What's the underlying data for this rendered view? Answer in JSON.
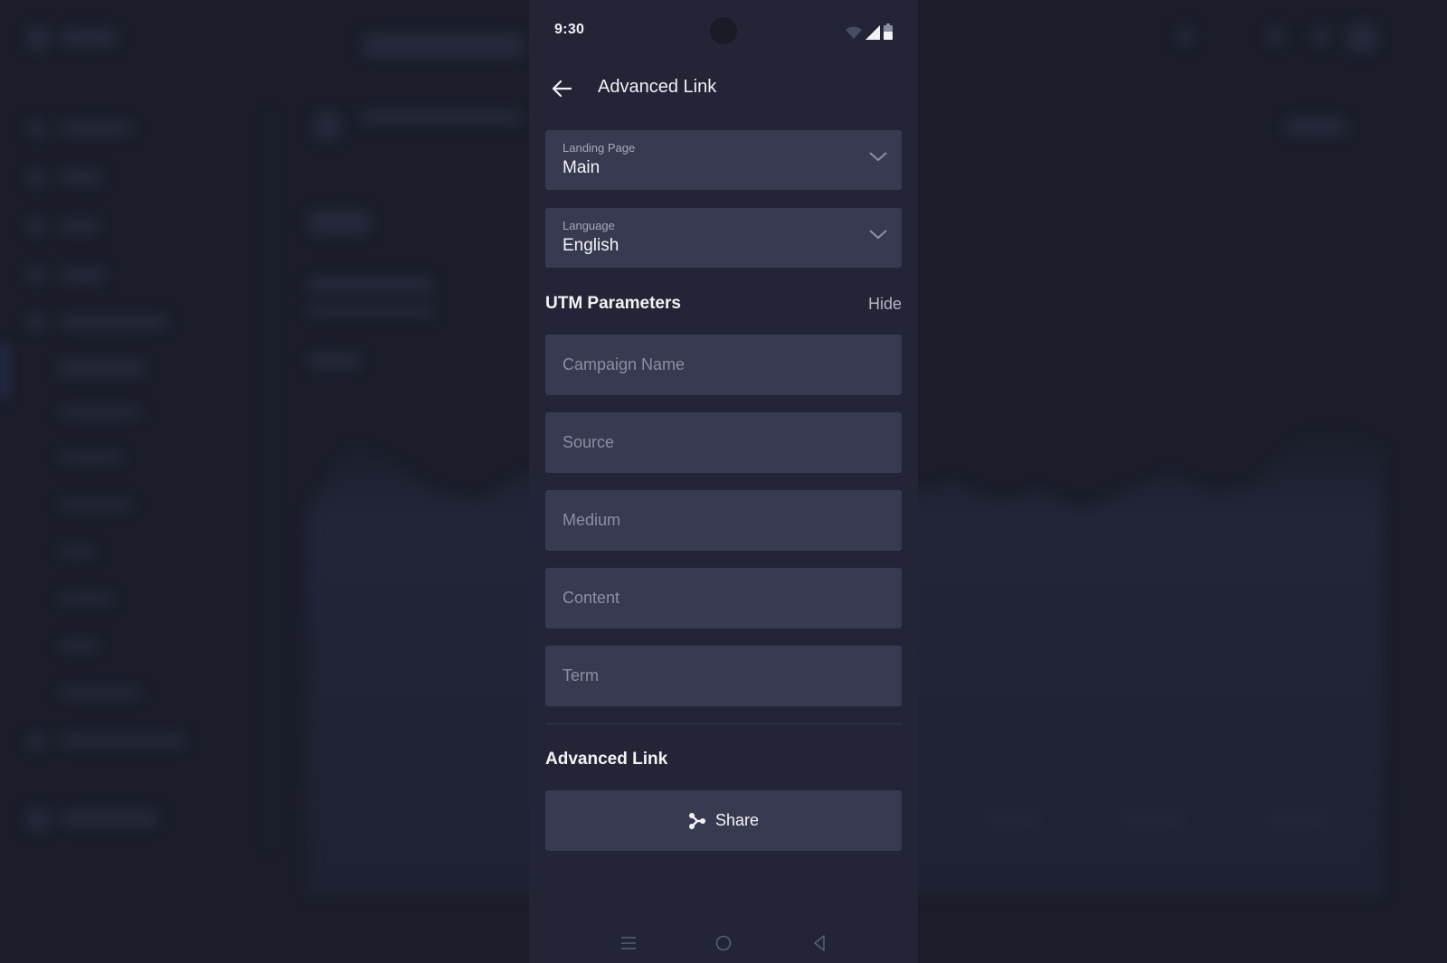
{
  "status_bar": {
    "time": "9:30",
    "icons": [
      "wifi-icon",
      "cellular-signal-icon",
      "battery-icon"
    ]
  },
  "app_bar": {
    "back_icon": "arrow-left-icon",
    "title": "Advanced Link"
  },
  "form": {
    "landing_page": {
      "label": "Landing Page",
      "value": "Main"
    },
    "language": {
      "label": "Language",
      "value": "English"
    },
    "utm": {
      "title": "UTM Parameters",
      "toggle_label": "Hide",
      "fields": [
        {
          "placeholder": "Campaign Name",
          "value": ""
        },
        {
          "placeholder": "Source",
          "value": ""
        },
        {
          "placeholder": "Medium",
          "value": ""
        },
        {
          "placeholder": "Content",
          "value": ""
        },
        {
          "placeholder": "Term",
          "value": ""
        }
      ]
    },
    "advanced_link": {
      "title": "Advanced Link",
      "share_label": "Share",
      "share_icon": "share-icon"
    }
  },
  "nav_bar": {
    "icons": [
      "recent-apps-icon",
      "home-icon",
      "back-icon"
    ]
  },
  "colors": {
    "background": "#232537",
    "field": "#383a52",
    "text": "#f3f3f6",
    "muted": "#8c8ea3"
  }
}
